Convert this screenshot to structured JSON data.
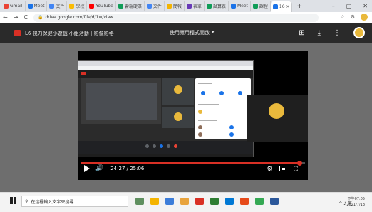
{
  "browser": {
    "tabs": [
      {
        "label": "Gmail",
        "color": "#ea4335"
      },
      {
        "label": "Meet",
        "color": "#1a73e8"
      },
      {
        "label": "文件",
        "color": "#4285f4"
      },
      {
        "label": "學校",
        "color": "#fbbc04"
      },
      {
        "label": "YouTube",
        "color": "#ff0000"
      },
      {
        "label": "雲端硬碟",
        "color": "#0f9d58"
      },
      {
        "label": "文件",
        "color": "#4285f4"
      },
      {
        "label": "簡報",
        "color": "#f4b400"
      },
      {
        "label": "表單",
        "color": "#673ab7"
      },
      {
        "label": "試算表",
        "color": "#0f9d58"
      },
      {
        "label": "Meet",
        "color": "#1a73e8"
      },
      {
        "label": "課程",
        "color": "#0f9d58"
      },
      {
        "label": "16 ×",
        "color": "#1a73e8",
        "active": true
      }
    ],
    "new_tab": "+",
    "win_controls": [
      "–",
      "▢",
      "✕"
    ],
    "address": "drive.google.com/file/d/1w/view",
    "lock": "🔒"
  },
  "drive": {
    "file_title": "L6 視力保健小遊戲 小組活動 | 影像影格",
    "open_with": "使用應用程式開啟",
    "caret": "▾",
    "tools": [
      "⊞",
      "⤓",
      "⋮"
    ]
  },
  "player": {
    "time": "24:27 / 25:06",
    "progress": 0.974,
    "right_icons": [
      "cc",
      "settings",
      "miniplayer",
      "fullscreen"
    ]
  },
  "taskbar": {
    "search_placeholder": "在這裡輸入文字來搜尋",
    "clock_time": "下午07:05",
    "clock_date": "2021/7/13",
    "tray": "^ ♪ 英"
  }
}
